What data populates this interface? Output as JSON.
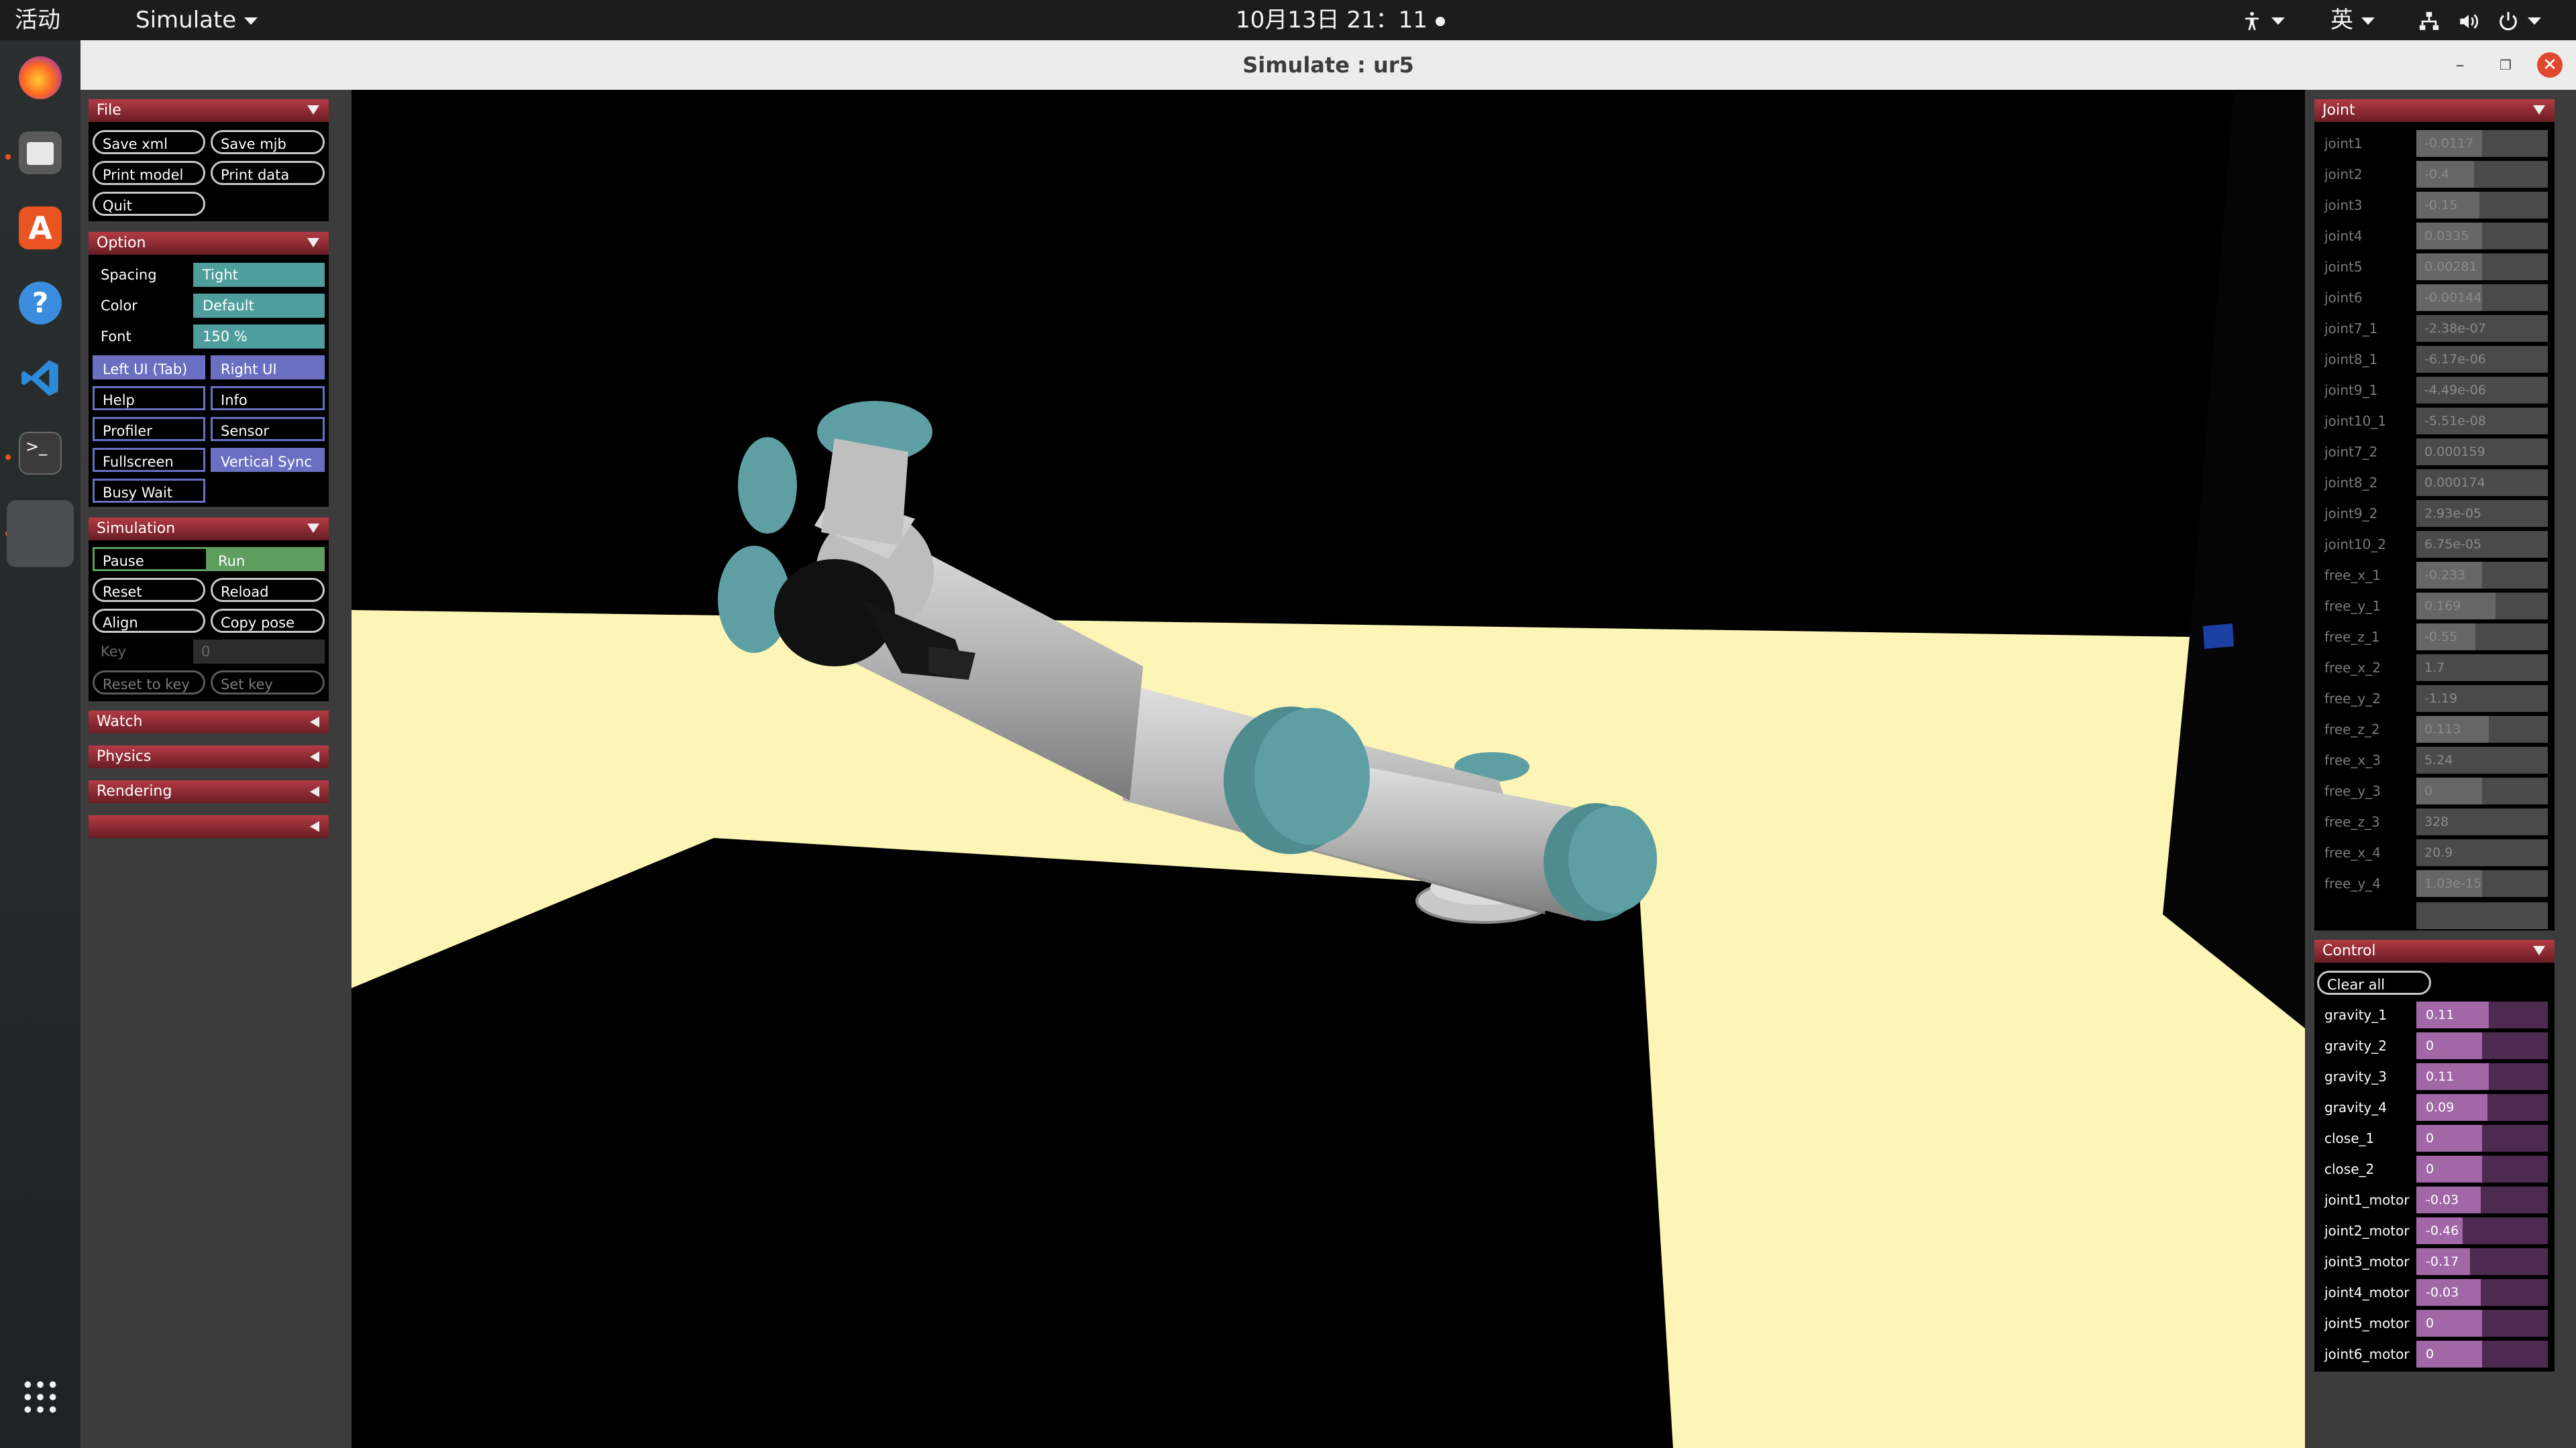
{
  "topbar": {
    "activities": "活动",
    "app_menu": "Simulate",
    "datetime": "10月13日  21：11",
    "input_method": "英"
  },
  "window": {
    "title": "Simulate : ur5"
  },
  "left": {
    "file": {
      "header": "File",
      "save_xml": "Save xml",
      "save_mjb": "Save mjb",
      "print_model": "Print model",
      "print_data": "Print data",
      "quit": "Quit"
    },
    "option": {
      "header": "Option",
      "spacing_label": "Spacing",
      "spacing_value": "Tight",
      "color_label": "Color",
      "color_value": "Default",
      "font_label": "Font",
      "font_value": "150 %",
      "left_ui": "Left UI (Tab)",
      "right_ui": "Right UI",
      "help": "Help",
      "info": "Info",
      "profiler": "Profiler",
      "sensor": "Sensor",
      "fullscreen": "Fullscreen",
      "vertical_sync": "Vertical Sync",
      "busy_wait": "Busy Wait"
    },
    "simulation": {
      "header": "Simulation",
      "pause": "Pause",
      "run": "Run",
      "reset": "Reset",
      "reload": "Reload",
      "align": "Align",
      "copy_pose": "Copy pose",
      "key_label": "Key",
      "key_value": "0",
      "reset_to_key": "Reset to key",
      "set_key": "Set key"
    },
    "watch": "Watch",
    "physics": "Physics",
    "rendering": "Rendering",
    "extra": ""
  },
  "joint": {
    "header": "Joint",
    "rows": [
      {
        "name": "joint1",
        "value": "-0.0117",
        "fill": 0.5
      },
      {
        "name": "joint2",
        "value": "-0.4",
        "fill": 0.44
      },
      {
        "name": "joint3",
        "value": "-0.15",
        "fill": 0.48
      },
      {
        "name": "joint4",
        "value": "0.0335",
        "fill": 0.5
      },
      {
        "name": "joint5",
        "value": "0.00281",
        "fill": 0.5
      },
      {
        "name": "joint6",
        "value": "-0.00144",
        "fill": 0.5
      },
      {
        "name": "joint7_1",
        "value": "-2.38e-07",
        "fill": 0.0
      },
      {
        "name": "joint8_1",
        "value": "-6.17e-06",
        "fill": 0.0
      },
      {
        "name": "joint9_1",
        "value": "-4.49e-06",
        "fill": 0.0
      },
      {
        "name": "joint10_1",
        "value": "-5.51e-08",
        "fill": 0.0
      },
      {
        "name": "joint7_2",
        "value": "0.000159",
        "fill": 0.0
      },
      {
        "name": "joint8_2",
        "value": "0.000174",
        "fill": 0.0
      },
      {
        "name": "joint9_2",
        "value": "2.93e-05",
        "fill": 0.0
      },
      {
        "name": "joint10_2",
        "value": "6.75e-05",
        "fill": 0.0
      },
      {
        "name": "free_x_1",
        "value": "-0.233",
        "fill": 0.5
      },
      {
        "name": "free_y_1",
        "value": "0.169",
        "fill": 0.6
      },
      {
        "name": "free_z_1",
        "value": "-0.55",
        "fill": 0.45
      },
      {
        "name": "free_x_2",
        "value": "1.7",
        "fill": 0.0
      },
      {
        "name": "free_y_2",
        "value": "-1.19",
        "fill": 0.0
      },
      {
        "name": "free_z_2",
        "value": "0.113",
        "fill": 0.55
      },
      {
        "name": "free_x_3",
        "value": "5.24",
        "fill": 0.0
      },
      {
        "name": "free_y_3",
        "value": "0",
        "fill": 0.5
      },
      {
        "name": "free_z_3",
        "value": "328",
        "fill": 0.0
      },
      {
        "name": "free_x_4",
        "value": "20.9",
        "fill": 0.0
      },
      {
        "name": "free_y_4",
        "value": "1.03e-15",
        "fill": 0.5
      }
    ]
  },
  "control": {
    "header": "Control",
    "clear_all": "Clear all",
    "rows": [
      {
        "name": "gravity_1",
        "value": "0.11",
        "fill": 0.55
      },
      {
        "name": "gravity_2",
        "value": "0",
        "fill": 0.5
      },
      {
        "name": "gravity_3",
        "value": "0.11",
        "fill": 0.55
      },
      {
        "name": "gravity_4",
        "value": "0.09",
        "fill": 0.54
      },
      {
        "name": "close_1",
        "value": "0",
        "fill": 0.5
      },
      {
        "name": "close_2",
        "value": "0",
        "fill": 0.5
      },
      {
        "name": "joint1_motor",
        "value": "-0.03",
        "fill": 0.49
      },
      {
        "name": "joint2_motor",
        "value": "-0.46",
        "fill": 0.35
      },
      {
        "name": "joint3_motor",
        "value": "-0.17",
        "fill": 0.41
      },
      {
        "name": "joint4_motor",
        "value": "-0.03",
        "fill": 0.49
      },
      {
        "name": "joint5_motor",
        "value": "0",
        "fill": 0.5
      },
      {
        "name": "joint6_motor",
        "value": "0",
        "fill": 0.5
      }
    ]
  },
  "colors": {
    "header_red": "#b33a44",
    "option_teal": "#4f9e9e",
    "toggle_purple": "#6b6fc2",
    "run_green": "#5f9e5f",
    "control_purple": "#a167a7",
    "floor_cream": "#fdf5b5",
    "arm_cap_teal": "#5e9fa3"
  },
  "icons": [
    "firefox-icon",
    "files-icon",
    "app-store-icon",
    "help-icon",
    "vscode-icon",
    "terminal-icon",
    "app-grid-icon",
    "network-icon",
    "volume-icon",
    "power-icon",
    "accessibility-icon"
  ]
}
